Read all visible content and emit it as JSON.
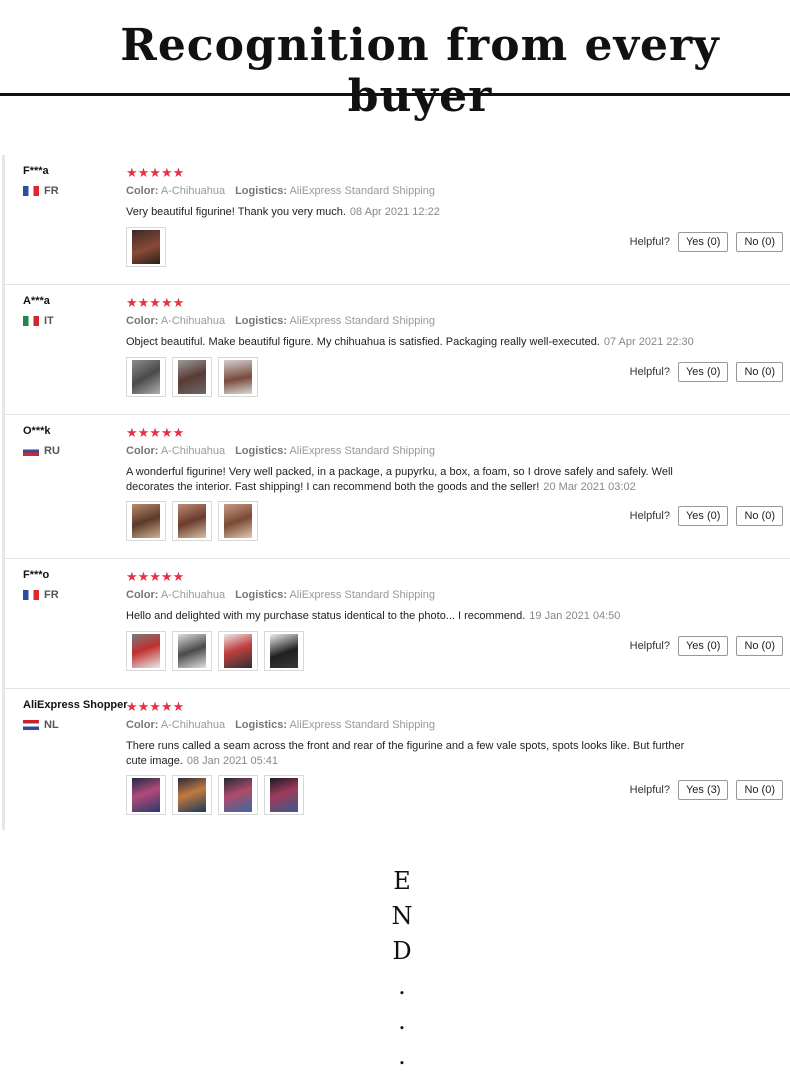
{
  "banner": {
    "title": "Recognition from every buyer"
  },
  "labels": {
    "color": "Color:",
    "logistics": "Logistics:",
    "helpful": "Helpful?",
    "stars": "★★★★★"
  },
  "reviews": [
    {
      "user": "F***a",
      "country": "FR",
      "color": "A-Chihuahua",
      "logistics": "AliExpress Standard Shipping",
      "text": "Very beautiful figurine! Thank you very much.",
      "date": "08 Apr 2021 12:22",
      "yes": "Yes (0)",
      "no": "No (0)",
      "photos": 1
    },
    {
      "user": "A***a",
      "country": "IT",
      "color": "A-Chihuahua",
      "logistics": "AliExpress Standard Shipping",
      "text": "Object beautiful. Make beautiful figure. My chihuahua is satisfied. Packaging really well-executed.",
      "date": "07 Apr 2021 22:30",
      "yes": "Yes (0)",
      "no": "No (0)",
      "photos": 3
    },
    {
      "user": "O***k",
      "country": "RU",
      "color": "A-Chihuahua",
      "logistics": "AliExpress Standard Shipping",
      "text": "A wonderful figurine! Very well packed, in a package, a pupyrku, a box, a foam, so I drove safely and safely. Well decorates the interior. Fast shipping! I can recommend both the goods and the seller!",
      "date": "20 Mar 2021 03:02",
      "yes": "Yes (0)",
      "no": "No (0)",
      "photos": 3
    },
    {
      "user": "F***o",
      "country": "FR",
      "color": "A-Chihuahua",
      "logistics": "AliExpress Standard Shipping",
      "text": "Hello and delighted with my purchase status identical to the photo... I recommend.",
      "date": "19 Jan 2021 04:50",
      "yes": "Yes (0)",
      "no": "No (0)",
      "photos": 4
    },
    {
      "user": "AliExpress Shopper",
      "country": "NL",
      "color": "A-Chihuahua",
      "logistics": "AliExpress Standard Shipping",
      "text": "There runs called a seam across the front and rear of the figurine and a few vale spots, spots looks like. But further cute image.",
      "date": "08 Jan 2021 05:41",
      "yes": "Yes (3)",
      "no": "No (0)",
      "photos": 4
    }
  ],
  "end": [
    "E",
    "N",
    "D",
    ".",
    ".",
    "."
  ],
  "colors": {
    "star": "#e43343",
    "flag_fr": "#2b4ea2"
  }
}
